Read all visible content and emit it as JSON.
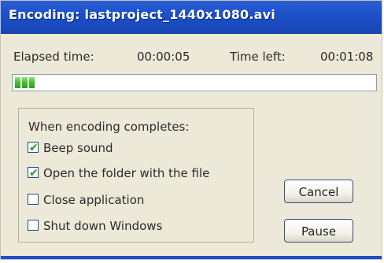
{
  "window": {
    "title": "Encoding: lastproject_1440x1080.avi"
  },
  "timing": {
    "elapsed_label": "Elapsed time:",
    "elapsed_value": "00:00:05",
    "left_label": "Time left:",
    "left_value": "00:01:08"
  },
  "progress": {
    "filled_segments": 3,
    "fraction": 0.07,
    "color": "#3fbf2a"
  },
  "completion": {
    "heading": "When encoding completes:",
    "options": [
      {
        "label": "Beep sound",
        "checked": true
      },
      {
        "label": "Open the folder with the file",
        "checked": true
      },
      {
        "label": "Close application",
        "checked": false
      },
      {
        "label": "Shut down Windows",
        "checked": false
      }
    ]
  },
  "buttons": {
    "cancel": "Cancel",
    "pause": "Pause"
  },
  "colors": {
    "titlebar": "#1c4fc8",
    "window_bg": "#ece9d8",
    "check": "#1f9a24"
  }
}
